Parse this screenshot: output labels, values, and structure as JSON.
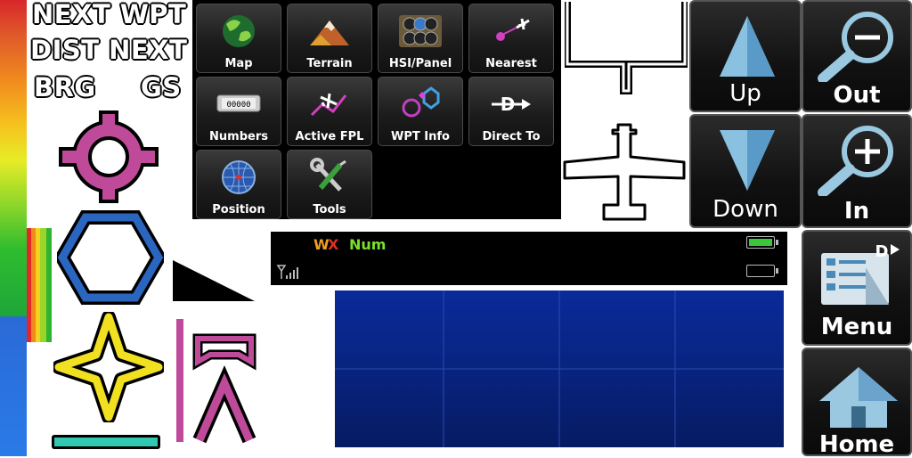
{
  "sprite_labels": {
    "next_wpt": "NEXT WPT",
    "dist_next": "DIST NEXT",
    "brg": "BRG",
    "gs": "GS"
  },
  "menu": {
    "tiles": [
      {
        "label": "Map",
        "icon": "map-icon"
      },
      {
        "label": "Terrain",
        "icon": "terrain-icon"
      },
      {
        "label": "HSI/Panel",
        "icon": "hsi-panel-icon"
      },
      {
        "label": "Nearest",
        "icon": "nearest-icon"
      },
      {
        "label": "Numbers",
        "icon": "numbers-icon"
      },
      {
        "label": "Active FPL",
        "icon": "active-fpl-icon"
      },
      {
        "label": "WPT Info",
        "icon": "wpt-info-icon"
      },
      {
        "label": "Direct To",
        "icon": "direct-to-icon"
      },
      {
        "label": "Position",
        "icon": "position-icon"
      },
      {
        "label": "Tools",
        "icon": "tools-icon"
      }
    ]
  },
  "buttons": {
    "up": "Up",
    "down": "Down",
    "out": "Out",
    "in": "In",
    "menu": "Menu",
    "home": "Home"
  },
  "status": {
    "wx_w": "W",
    "wx_x": "X",
    "num": "Num",
    "battery_level": 1.0
  },
  "colors": {
    "magenta": "#c04a9a",
    "blue": "#2a66c0",
    "yellow": "#f0e020",
    "teal": "#30c8b0",
    "map_blue": "#0a2a9a"
  }
}
